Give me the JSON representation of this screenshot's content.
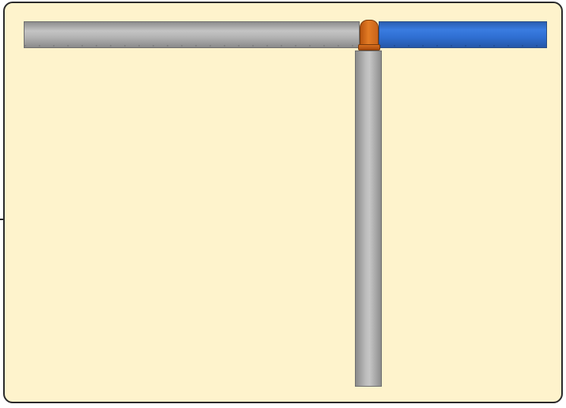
{
  "board": {
    "background_color": "#fef3cc",
    "border_color": "#2b2b2b"
  },
  "pieces": [
    {
      "name": "horizontal-pipe-gray",
      "color": "#b3b3b3",
      "state": "empty"
    },
    {
      "name": "horizontal-pipe-blue",
      "color": "#3a7ce0",
      "state": "filled"
    },
    {
      "name": "vertical-pipe-gray",
      "color": "#b3b3b3",
      "state": "empty"
    },
    {
      "name": "t-joint-connector",
      "color": "#e37c24"
    }
  ]
}
